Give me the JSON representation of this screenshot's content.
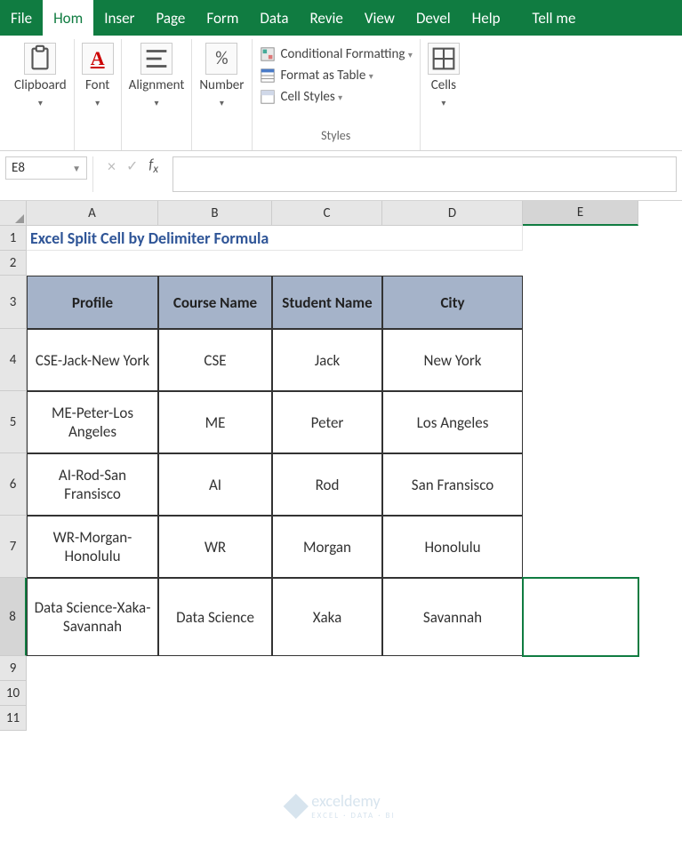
{
  "menu": {
    "items": [
      "File",
      "Hom",
      "Inser",
      "Page",
      "Form",
      "Data",
      "Revie",
      "View",
      "Devel",
      "Help"
    ],
    "active_index": 1,
    "tell_me": "Tell me"
  },
  "ribbon": {
    "groups": [
      {
        "label": "Clipboard",
        "big": {
          "label": "Clipboard",
          "drop": true
        }
      },
      {
        "label": "Font",
        "big": {
          "label": "Font",
          "drop": true
        }
      },
      {
        "label": "Alignment",
        "big": {
          "label": "Alignment",
          "drop": true
        }
      },
      {
        "label": "Number",
        "big": {
          "label": "Number",
          "drop": true
        }
      },
      {
        "label": "Styles",
        "items": [
          "Conditional Formatting",
          "Format as Table",
          "Cell Styles"
        ]
      },
      {
        "label": "Cells",
        "big": {
          "label": "Cells",
          "drop": true
        }
      }
    ]
  },
  "formula_bar": {
    "name_box": "E8",
    "formula": ""
  },
  "columns": {
    "labels": [
      "A",
      "B",
      "C",
      "D",
      "E"
    ],
    "widths": [
      148,
      128,
      124,
      158,
      130
    ],
    "selected": 4
  },
  "rows": {
    "heights": [
      28,
      28,
      60,
      70,
      70,
      70,
      70,
      88,
      28,
      28,
      28
    ],
    "selected": 7,
    "count": 11
  },
  "data": {
    "title": "Excel Split Cell by Delimiter Formula",
    "headers": [
      "Profile",
      "Course Name",
      "Student Name",
      "City"
    ],
    "body": [
      [
        "CSE-Jack-New York",
        "CSE",
        "Jack",
        "New York"
      ],
      [
        "ME-Peter-Los Angeles",
        "ME",
        "Peter",
        "Los Angeles"
      ],
      [
        "AI-Rod-San Fransisco",
        "AI",
        "Rod",
        "San Fransisco"
      ],
      [
        "WR-Morgan-Honolulu",
        "WR",
        "Morgan",
        "Honolulu"
      ],
      [
        "Data Science-Xaka-Savannah",
        "Data Science",
        "Xaka",
        "Savannah"
      ]
    ]
  },
  "watermark": {
    "text": "exceldemy",
    "tagline": "EXCEL · DATA · BI"
  },
  "selected_cell": {
    "col": 4,
    "row": 7
  }
}
